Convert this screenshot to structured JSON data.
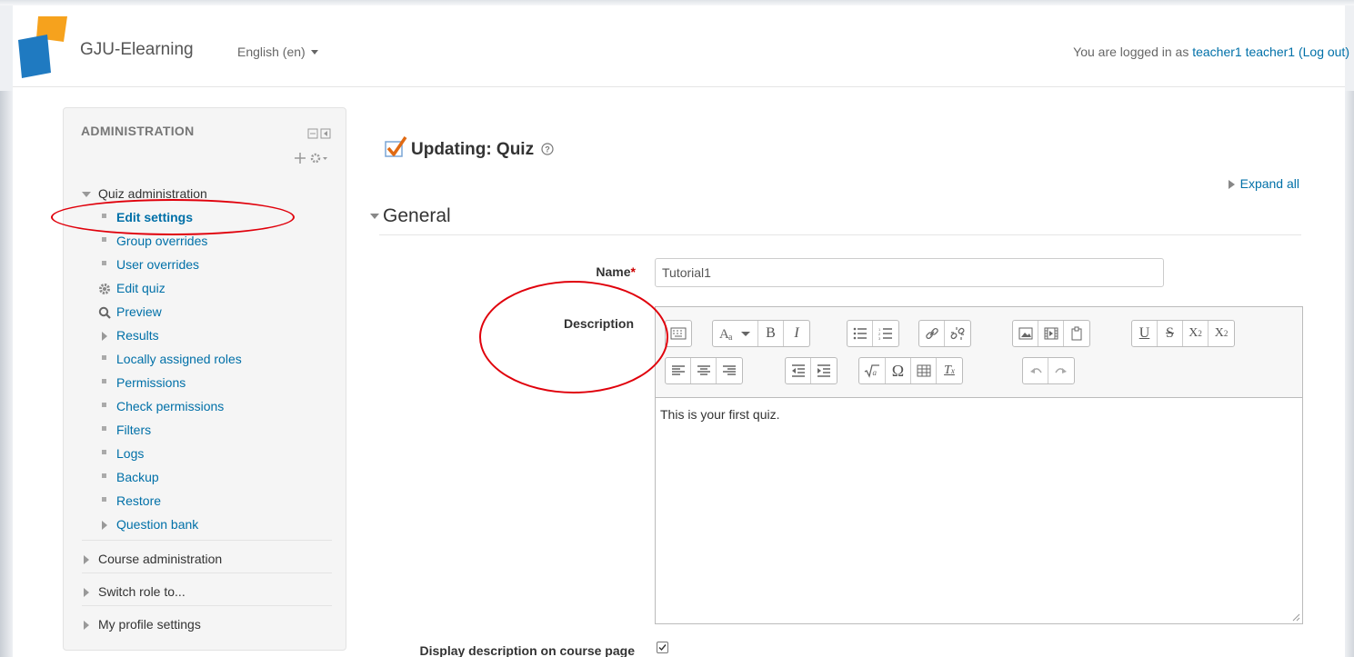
{
  "colors": {
    "accent_link": "#0070a8",
    "highlight_circle": "#e0000b",
    "required_star": "#cc0000"
  },
  "header": {
    "brand": "GJU-Elearning",
    "language": "English (en)",
    "login_prefix": "You are logged in as ",
    "username": "teacher1 teacher1",
    "logout_label": "(Log out)"
  },
  "sidebar": {
    "title": "ADMINISTRATION",
    "quiz_admin": {
      "label": "Quiz administration",
      "items": [
        {
          "label": "Edit settings",
          "icon": "bullet-square"
        },
        {
          "label": "Group overrides",
          "icon": "bullet-square"
        },
        {
          "label": "User overrides",
          "icon": "bullet-square"
        },
        {
          "label": "Edit quiz",
          "icon": "gear-icon"
        },
        {
          "label": "Preview",
          "icon": "magnifier-icon"
        },
        {
          "label": "Results",
          "icon": "triangle-right"
        },
        {
          "label": "Locally assigned roles",
          "icon": "bullet-square"
        },
        {
          "label": "Permissions",
          "icon": "bullet-square"
        },
        {
          "label": "Check permissions",
          "icon": "bullet-square"
        },
        {
          "label": "Filters",
          "icon": "bullet-square"
        },
        {
          "label": "Logs",
          "icon": "bullet-square"
        },
        {
          "label": "Backup",
          "icon": "bullet-square"
        },
        {
          "label": "Restore",
          "icon": "bullet-square"
        },
        {
          "label": "Question bank",
          "icon": "triangle-right"
        }
      ]
    },
    "course_admin": "Course administration",
    "switch_role": "Switch role to...",
    "profile_settings": "My profile settings"
  },
  "main": {
    "title": "Updating: Quiz",
    "expand_all": "Expand all",
    "section": "General",
    "name_label": "Name",
    "required_mark": "*",
    "name_value": "Tutorial1",
    "description_label": "Description",
    "description_text": "This is your first quiz.",
    "display_description_label": "Display description on course page",
    "display_description_checked": true
  },
  "editor_toolbar": {
    "row1": [
      "toolbar-toggle",
      "font-style",
      "bold",
      "italic",
      "unordered-list",
      "ordered-list",
      "link",
      "unlink",
      "image",
      "media",
      "manage-files",
      "underline",
      "strikethrough",
      "subscript",
      "superscript"
    ],
    "row2": [
      "align-left",
      "align-center",
      "align-right",
      "outdent",
      "indent",
      "equation",
      "special-character",
      "table",
      "clear-formatting",
      "undo",
      "redo"
    ],
    "glyphs": {
      "bold": "B",
      "italic": "I",
      "underline": "U",
      "strikethrough": "S",
      "subscript_base": "X",
      "subscript_sub": "2",
      "superscript_base": "X",
      "superscript_sup": "2",
      "omega": "Ω",
      "clear": "T",
      "clear_sub": "x"
    }
  }
}
